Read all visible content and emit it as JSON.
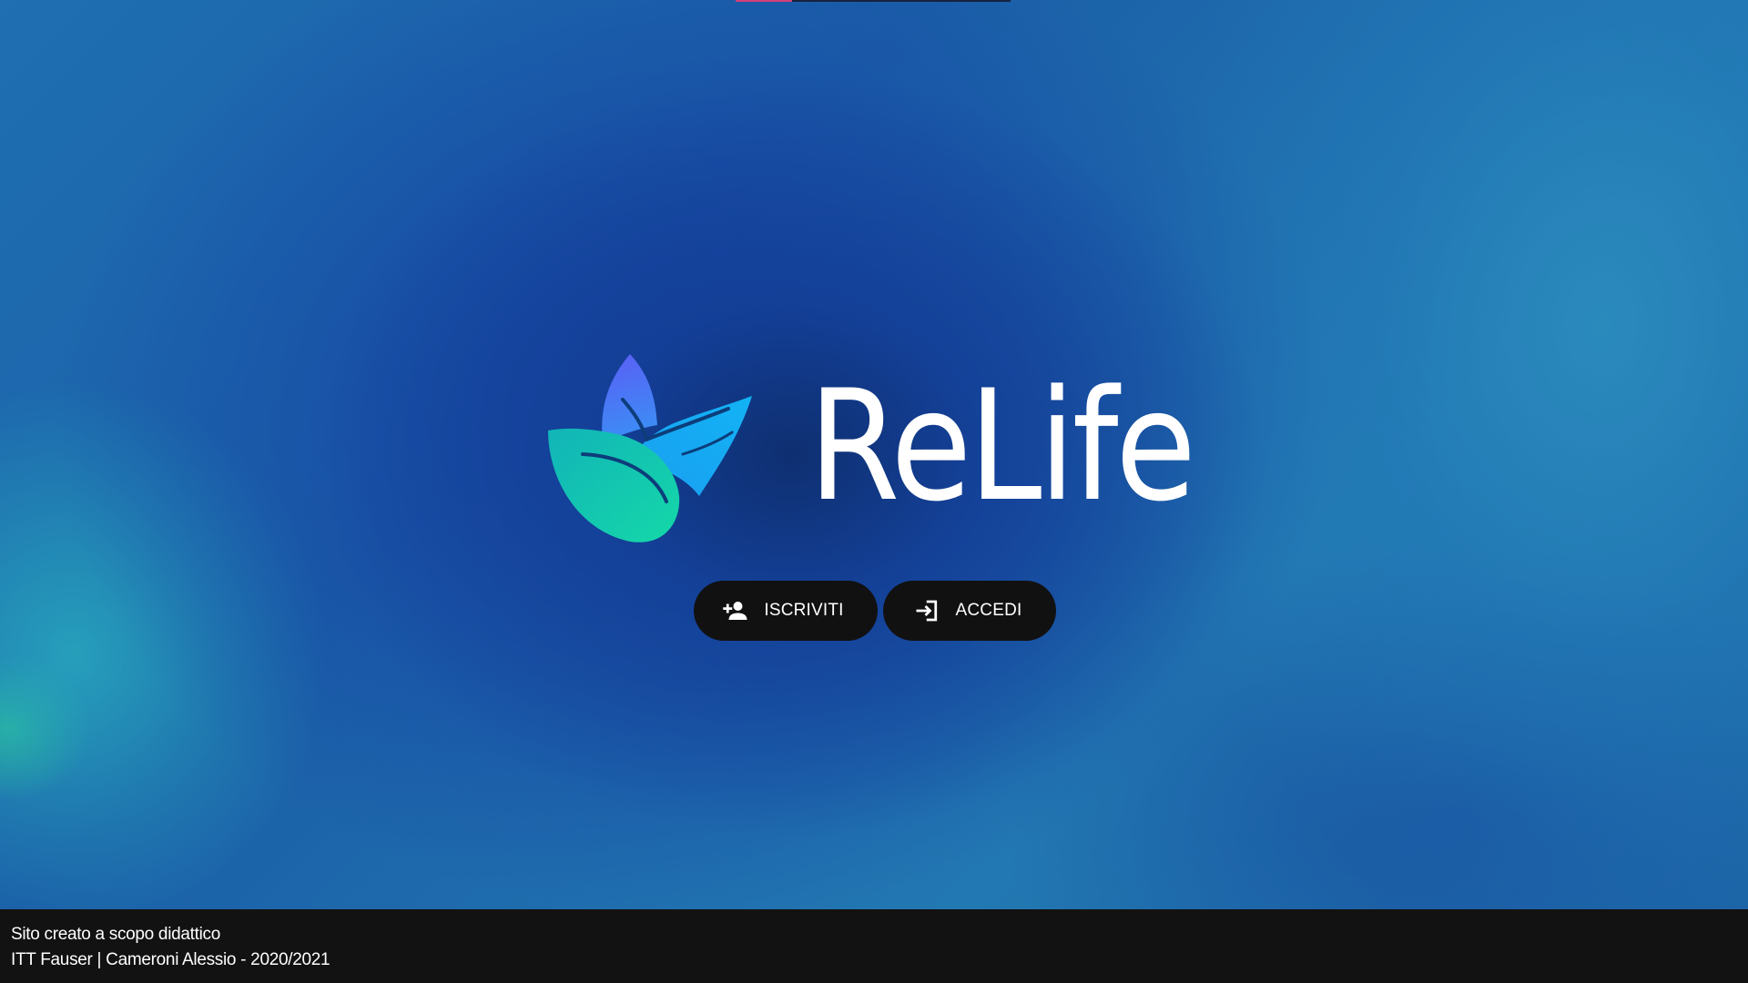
{
  "brand": {
    "name": "ReLife",
    "logo_icon": "leaf-logo-icon",
    "logo_gradient": [
      "#4a6cf7",
      "#13c9c9",
      "#0fd3a8",
      "#1aa7f0"
    ]
  },
  "actions": {
    "signup": {
      "label": "ISCRIVITI",
      "icon": "person-add-icon"
    },
    "login": {
      "label": "ACCEDI",
      "icon": "login-icon"
    }
  },
  "footer": {
    "line1": "Sito creato a scopo didattico",
    "line2": "ITT Fauser | Cameroni Alessio - 2020/2021"
  },
  "colors": {
    "background": "#1d6aa8",
    "button_bg": "#111111",
    "footer_bg": "#121212",
    "text": "#ffffff"
  }
}
